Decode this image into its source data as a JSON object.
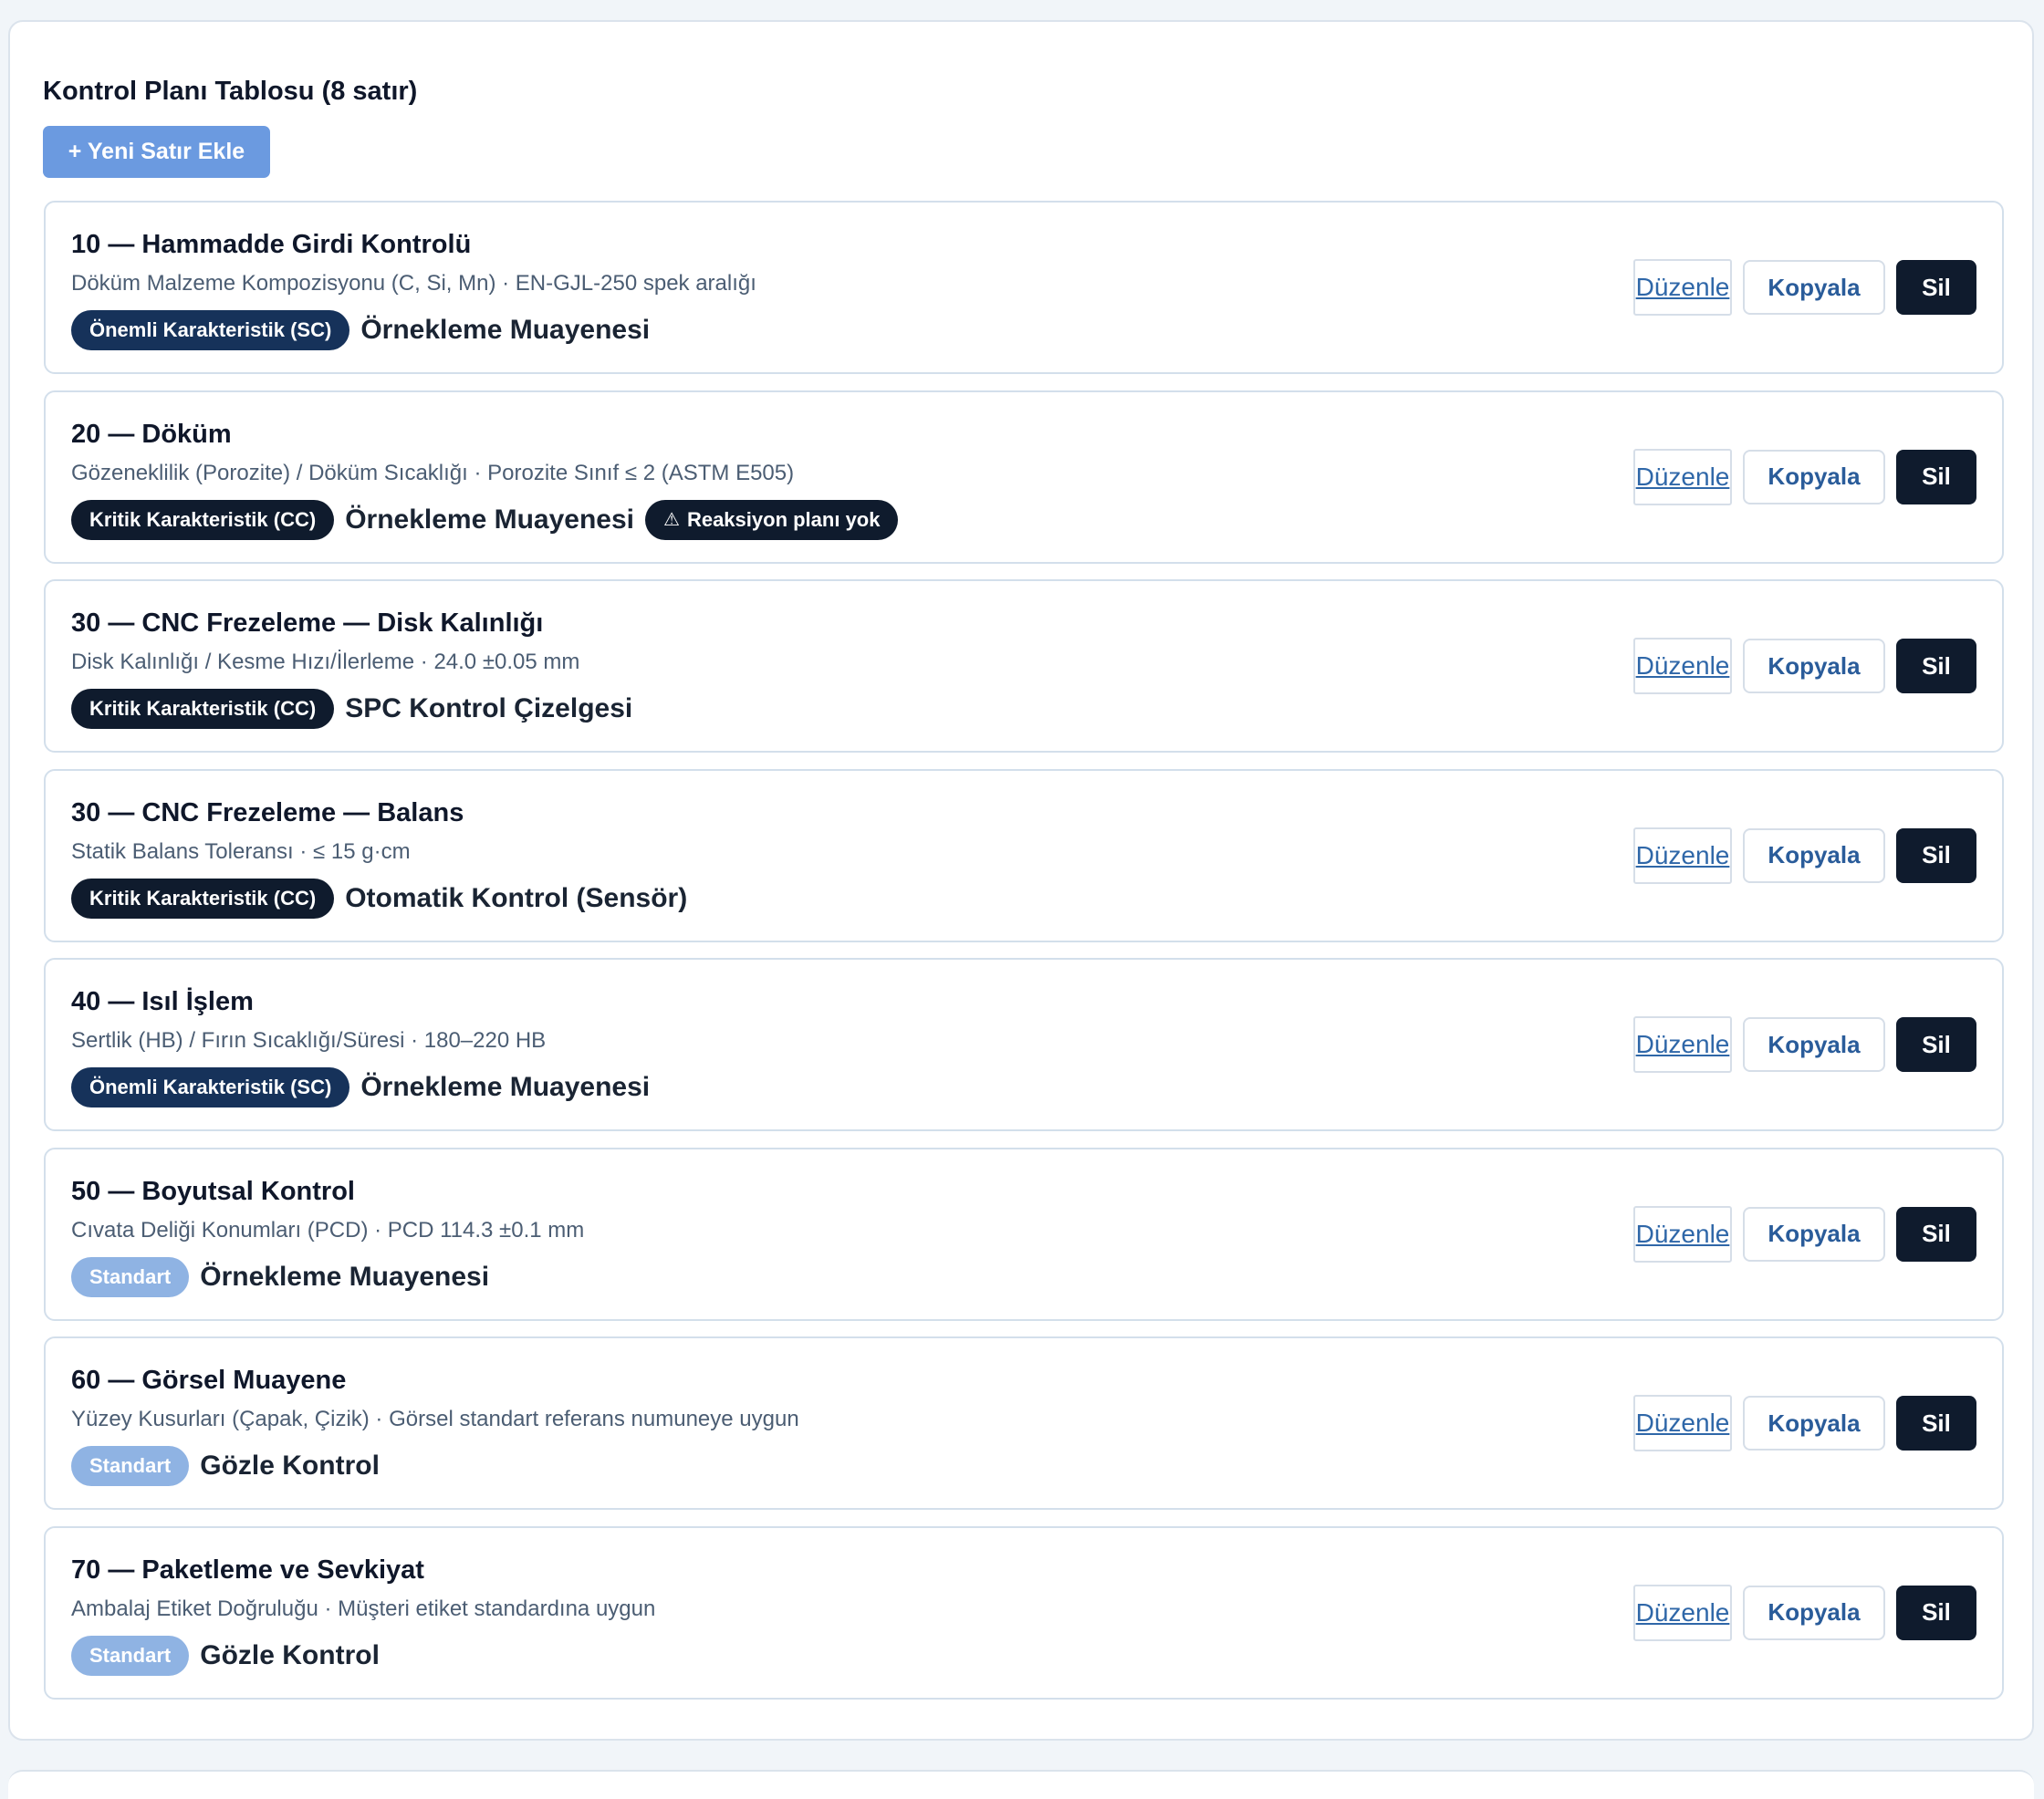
{
  "panel": {
    "title": "Kontrol Planı Tablosu (8 satır)",
    "add_button": "+ Yeni Satır Ekle"
  },
  "actions": {
    "edit": "Düzenle",
    "copy": "Kopyala",
    "delete": "Sil"
  },
  "rows": [
    {
      "title": "10 — Hammadde Girdi Kontrolü",
      "subtitle": "Döküm Malzeme Kompozisyonu (C, Si, Mn) · EN-GJL-250 spek aralığı",
      "badge": "Önemli Karakteristik (SC)",
      "badge_type": "sc",
      "method": "Örnekleme Muayenesi",
      "warning": ""
    },
    {
      "title": "20 — Döküm",
      "subtitle": "Gözeneklilik (Porozite) / Döküm Sıcaklığı · Porozite Sınıf ≤ 2 (ASTM E505)",
      "badge": "Kritik Karakteristik (CC)",
      "badge_type": "cc",
      "method": "Örnekleme Muayenesi",
      "warning": "Reaksiyon planı yok"
    },
    {
      "title": "30 — CNC Frezeleme — Disk Kalınlığı",
      "subtitle": "Disk Kalınlığı / Kesme Hızı/İlerleme · 24.0 ±0.05 mm",
      "badge": "Kritik Karakteristik (CC)",
      "badge_type": "cc",
      "method": "SPC Kontrol Çizelgesi",
      "warning": ""
    },
    {
      "title": "30 — CNC Frezeleme — Balans",
      "subtitle": "Statik Balans Toleransı · ≤ 15 g·cm",
      "badge": "Kritik Karakteristik (CC)",
      "badge_type": "cc",
      "method": "Otomatik Kontrol (Sensör)",
      "warning": ""
    },
    {
      "title": "40 — Isıl İşlem",
      "subtitle": "Sertlik (HB) / Fırın Sıcaklığı/Süresi · 180–220 HB",
      "badge": "Önemli Karakteristik (SC)",
      "badge_type": "sc",
      "method": "Örnekleme Muayenesi",
      "warning": ""
    },
    {
      "title": "50 — Boyutsal Kontrol",
      "subtitle": "Cıvata Deliği Konumları (PCD) · PCD 114.3 ±0.1 mm",
      "badge": "Standart",
      "badge_type": "std",
      "method": "Örnekleme Muayenesi",
      "warning": ""
    },
    {
      "title": "60 — Görsel Muayene",
      "subtitle": "Yüzey Kusurları (Çapak, Çizik) · Görsel standart referans numuneye uygun",
      "badge": "Standart",
      "badge_type": "std",
      "method": "Gözle Kontrol",
      "warning": ""
    },
    {
      "title": "70 — Paketleme ve Sevkiyat",
      "subtitle": "Ambalaj Etiket Doğruluğu · Müşteri etiket standardına uygun",
      "badge": "Standart",
      "badge_type": "std",
      "method": "Gözle Kontrol",
      "warning": ""
    }
  ],
  "colors": {
    "sc_badge": "#16325a",
    "cc_badge": "#0f1b2d",
    "std_badge": "#8fb3e3",
    "primary_button": "#6b9ae0",
    "delete_button": "#0f1b2d"
  }
}
